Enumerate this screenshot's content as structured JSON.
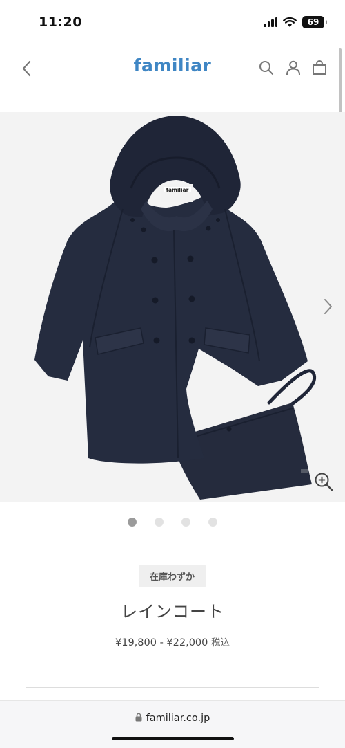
{
  "status_bar": {
    "time": "11:20",
    "battery": "69"
  },
  "header": {
    "logo": "familiar"
  },
  "gallery": {
    "current_index": 1,
    "count": 4,
    "label_tag": "familiar"
  },
  "product": {
    "stock_badge": "在庫わずか",
    "name": "レインコート",
    "price": "¥19,800 - ¥22,000",
    "tax_note": "税込"
  },
  "browser": {
    "url": "familiar.co.jp"
  },
  "colors": {
    "brand": "#3f86c4",
    "coat": "#232a3c",
    "gallery_bg": "#f3f3f3"
  },
  "icons": [
    "back-chevron-icon",
    "search-icon",
    "account-icon",
    "bag-icon",
    "next-chevron-icon",
    "zoom-in-icon",
    "lock-icon",
    "wifi-icon",
    "signal-icon",
    "battery-icon"
  ]
}
